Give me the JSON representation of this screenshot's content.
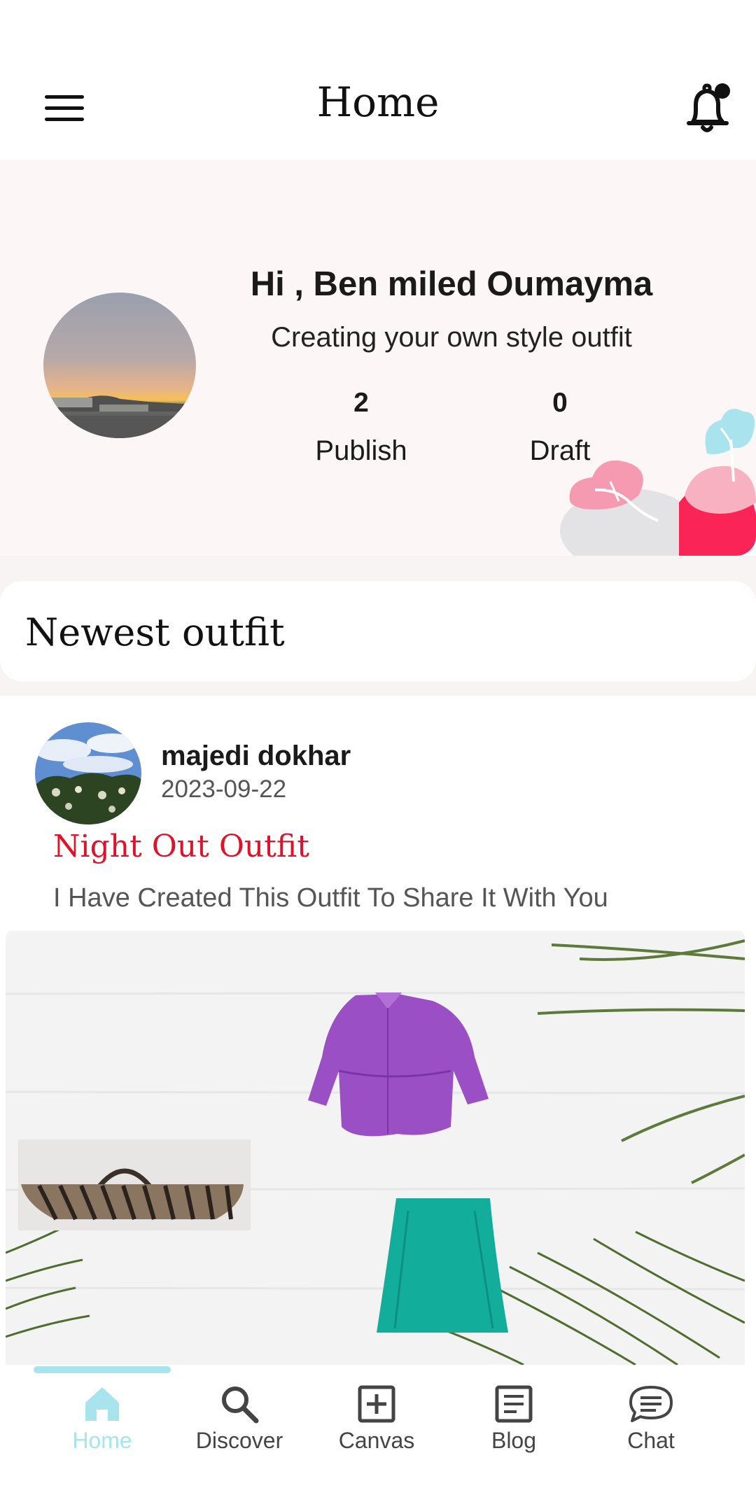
{
  "appbar": {
    "title": "Home"
  },
  "profile": {
    "greeting": "Hi , Ben miled Oumayma",
    "tagline": "Creating your own style outfit",
    "publish_count": "2",
    "publish_label": "Publish",
    "draft_count": "0",
    "draft_label": "Draft"
  },
  "section": {
    "title": "Newest outfit"
  },
  "post": {
    "author": "majedi dokhar",
    "date": "2023-09-22",
    "title": "Night Out Outfit",
    "description": "I Have Created This Outfit To Share It With You"
  },
  "nav": {
    "tabs": [
      {
        "label": "Home",
        "icon": "home-icon",
        "active": true
      },
      {
        "label": "Discover",
        "icon": "search-icon",
        "active": false
      },
      {
        "label": "Canvas",
        "icon": "plus-square-icon",
        "active": false
      },
      {
        "label": "Blog",
        "icon": "document-icon",
        "active": false
      },
      {
        "label": "Chat",
        "icon": "chat-icon",
        "active": false
      }
    ]
  },
  "colors": {
    "accent": "#a7e4ee",
    "post_title": "#e0112b",
    "profile_bg": "#fcf6f7"
  }
}
